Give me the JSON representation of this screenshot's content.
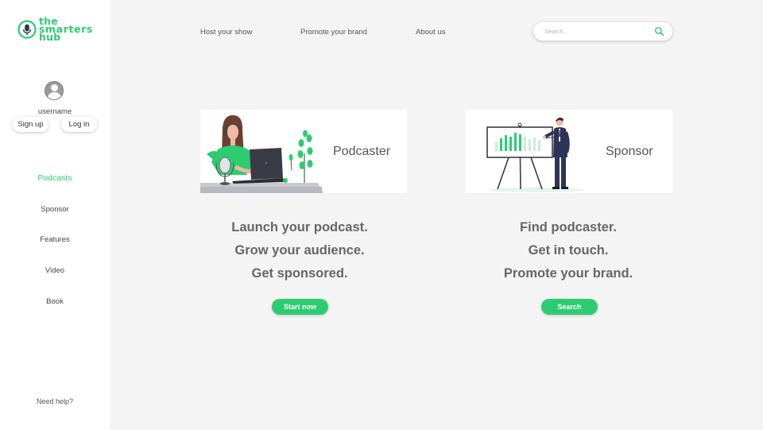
{
  "brand": {
    "line1": "the",
    "line2": "smarters",
    "line3": "hub",
    "accent": "#2ecc71"
  },
  "user": {
    "username": "username",
    "signup_label": "Sign up",
    "login_label": "Log in"
  },
  "sidebar": {
    "items": [
      {
        "label": "Podcasts",
        "active": true
      },
      {
        "label": "Sponsor",
        "active": false
      },
      {
        "label": "Features",
        "active": false
      },
      {
        "label": "Video",
        "active": false
      },
      {
        "label": "Book",
        "active": false
      }
    ],
    "help_label": "Need help?"
  },
  "topnav": {
    "links": [
      "Host your show",
      "Promote your brand",
      "About us"
    ],
    "search_placeholder": "Search..."
  },
  "podcaster": {
    "card_label": "Podcaster",
    "taglines": [
      "Launch your podcast.",
      "Grow your audience.",
      "Get sponsored."
    ],
    "cta_label": "Start now"
  },
  "sponsor": {
    "card_label": "Sponsor",
    "taglines": [
      "Find podcaster.",
      "Get in touch.",
      "Promote your brand."
    ],
    "cta_label": "Search"
  }
}
